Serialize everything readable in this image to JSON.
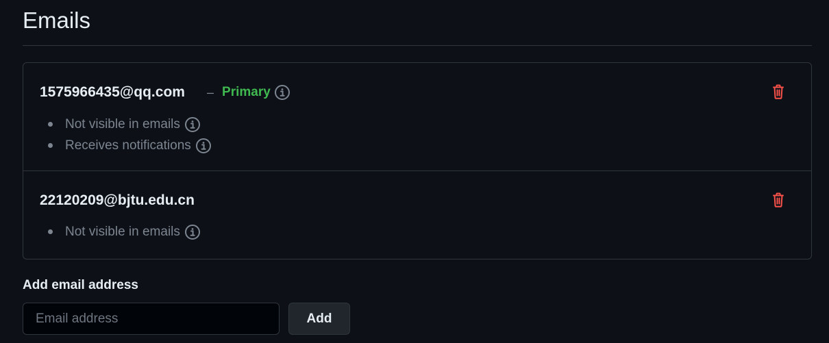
{
  "page": {
    "title": "Emails"
  },
  "emails": [
    {
      "address": "1575966435@qq.com",
      "separator": "–",
      "primary_label": "Primary",
      "bullets": [
        "Not visible in emails",
        "Receives notifications"
      ]
    },
    {
      "address": "22120209@bjtu.edu.cn",
      "bullets": [
        "Not visible in emails"
      ]
    }
  ],
  "add_email": {
    "label": "Add email address",
    "placeholder": "Email address",
    "value": "",
    "button_label": "Add"
  },
  "colors": {
    "background": "#0d1117",
    "border": "#30363d",
    "primary_green": "#3fb950",
    "delete_red": "#f85149",
    "muted_text": "#7d8590"
  },
  "icons": {
    "info": "info-icon",
    "delete": "trash-icon"
  }
}
